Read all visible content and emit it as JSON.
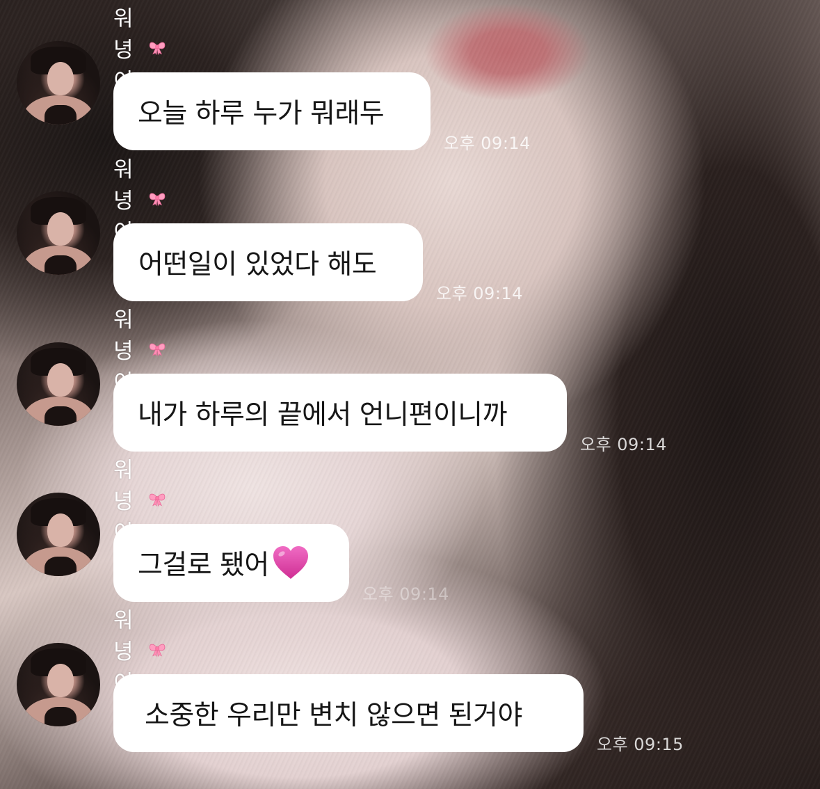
{
  "conversation": {
    "messages": [
      {
        "sender": "워녕이",
        "text": "오늘 하루 누가 뭐래두",
        "time": "오후 09:14"
      },
      {
        "sender": "워녕이",
        "text": "어떤일이 있었다 해도",
        "time": "오후 09:14"
      },
      {
        "sender": "워녕이",
        "text": "내가 하루의 끝에서 언니편이니까",
        "time": "오후 09:14"
      },
      {
        "sender": "워녕이",
        "text": "그걸로 됐어",
        "time": "오후 09:14",
        "emoji": "heart-icon"
      },
      {
        "sender": "워녕이",
        "text": "소중한 우리만 변치 않으면 된거야",
        "time": "오후 09:15"
      }
    ]
  },
  "icons": {
    "sender_decoration": "ribbon-bow-icon",
    "bow_color": "#ff8fb6",
    "heart_color": "#e33fa8"
  }
}
